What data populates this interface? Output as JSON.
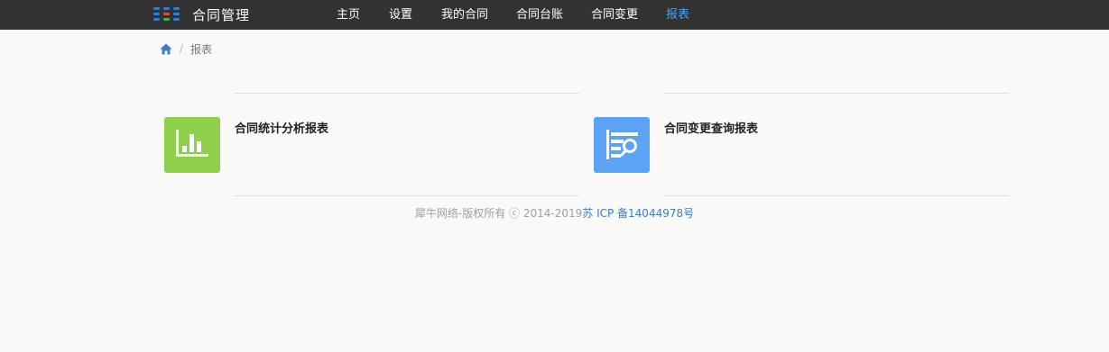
{
  "app": {
    "title": "合同管理",
    "logo_icon": "grid-dots-icon",
    "logo_colors": [
      "#2f7fd8",
      "#2f7fd8",
      "#2f7fd8",
      "#e04f2f",
      "#4caf50",
      "#2f7fd8"
    ]
  },
  "nav": {
    "items": [
      {
        "label": "主页",
        "active": false
      },
      {
        "label": "设置",
        "active": false
      },
      {
        "label": "我的合同",
        "active": false
      },
      {
        "label": "合同台账",
        "active": false
      },
      {
        "label": "合同变更",
        "active": false
      },
      {
        "label": "报表",
        "active": true
      }
    ],
    "active_color": "#4a9fe8"
  },
  "breadcrumb": {
    "home_icon": "home-icon",
    "separator": "/",
    "current": "报表"
  },
  "reports": [
    {
      "title": "合同统计分析报表",
      "icon": "bar-chart-icon",
      "color": "#8ed04b"
    },
    {
      "title": "合同变更查询报表",
      "icon": "list-search-icon",
      "color": "#5aa3f5"
    }
  ],
  "footer": {
    "copyright": "犀牛网络-版权所有 ⓒ 2014-2019",
    "icp_link": "苏 ICP 备14044978号"
  }
}
